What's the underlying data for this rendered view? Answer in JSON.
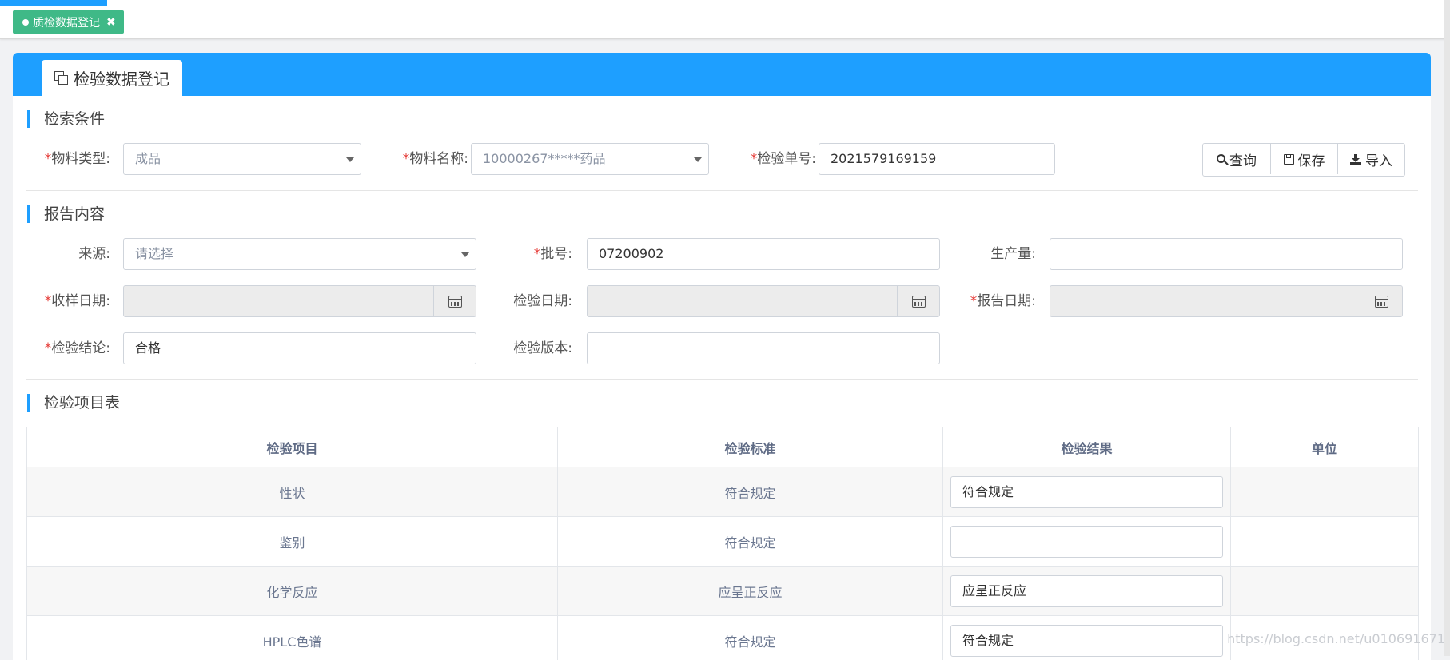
{
  "top_tab": {
    "label": "质检数据登记",
    "close": "✖"
  },
  "panel": {
    "tab_label": "检验数据登记"
  },
  "sections": {
    "search": "检索条件",
    "report": "报告内容",
    "items": "检验项目表"
  },
  "search": {
    "material_type": {
      "label": "物料类型:",
      "value": "成品"
    },
    "material_name": {
      "label": "物料名称:",
      "value": "10000267*****药品"
    },
    "inspection_no": {
      "label": "检验单号:",
      "value": "2021579169159"
    },
    "required_mark": "*"
  },
  "toolbar": {
    "query": "查询",
    "save": "保存",
    "import": "导入"
  },
  "report": {
    "source": {
      "label": "来源:",
      "placeholder": "请选择"
    },
    "batch_no": {
      "label": "批号:",
      "value": "07200902"
    },
    "production_qty": {
      "label": "生产量:",
      "value": ""
    },
    "sample_date": {
      "label": "收样日期:"
    },
    "inspection_date": {
      "label": "检验日期:"
    },
    "report_date": {
      "label": "报告日期:"
    },
    "conclusion": {
      "label": "检验结论:",
      "value": "合格"
    },
    "version": {
      "label": "检验版本:",
      "value": ""
    }
  },
  "table": {
    "headers": [
      "检验项目",
      "检验标准",
      "检验结果",
      "单位"
    ],
    "rows": [
      {
        "item": "性状",
        "standard": "符合规定",
        "result": "符合规定",
        "unit": ""
      },
      {
        "item": "鉴别",
        "standard": "符合规定",
        "result": "",
        "unit": ""
      },
      {
        "item": "化学反应",
        "standard": "应呈正反应",
        "result": "应呈正反应",
        "unit": ""
      },
      {
        "item": "HPLC色谱",
        "standard": "符合规定",
        "result": "符合规定",
        "unit": ""
      }
    ]
  },
  "watermark": "https://blog.csdn.net/u010691671",
  "colors": {
    "accent": "#1e9fff",
    "tab_green": "#3fb987",
    "required": "#e53935"
  }
}
